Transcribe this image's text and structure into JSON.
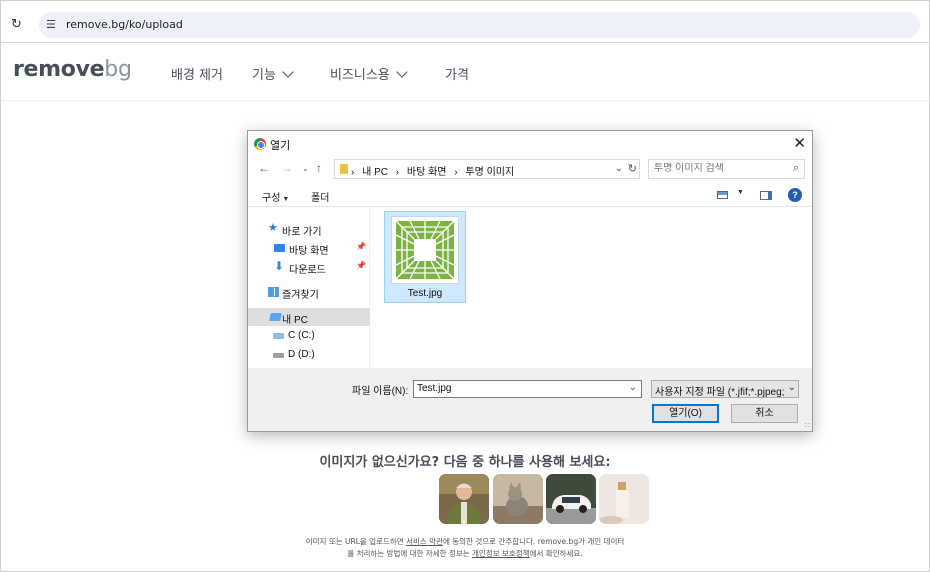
{
  "browser": {
    "url": "remove.bg/ko/upload"
  },
  "site": {
    "logo_main": "remove",
    "logo_accent": "bg",
    "nav": [
      {
        "label": "배경 제거",
        "dropdown": false
      },
      {
        "label": "기능",
        "dropdown": true
      },
      {
        "label": "비즈니스용",
        "dropdown": true
      },
      {
        "label": "가격",
        "dropdown": false
      }
    ]
  },
  "dialog": {
    "title": "열기",
    "path": [
      "내 PC",
      "바탕 화면",
      "투명 이미지"
    ],
    "search_placeholder": "투명 이미지 검색",
    "toolbar": {
      "organize": "구성",
      "new_folder": "폴더"
    },
    "sidebar": [
      {
        "label": "바로 가기",
        "icon": "star-icon"
      },
      {
        "label": "바탕 화면",
        "icon": "desktop-icon",
        "pinned": true
      },
      {
        "label": "다운로드",
        "icon": "download-icon",
        "pinned": true
      },
      {
        "label": "즐겨찾기",
        "icon": "favorites-icon"
      },
      {
        "label": "내 PC",
        "icon": "pc-icon",
        "selected": true
      },
      {
        "label": "C (C:)",
        "icon": "drive-c-icon"
      },
      {
        "label": "D (D:)",
        "icon": "drive-d-icon"
      }
    ],
    "files": [
      {
        "name": "Test.jpg",
        "selected": true
      }
    ],
    "filename_label": "파일 이름(N):",
    "filename_value": "Test.jpg",
    "filetype_value": "사용자 지정 파일 (*.jfif;*.pjpeg;",
    "open_label": "열기(O)",
    "cancel_label": "취소"
  },
  "page": {
    "prompt": "이미지가 없으신가요? 다음 중 하나를 사용해 보세요:",
    "samples": [
      "person-sample",
      "cat-sample",
      "car-sample",
      "cosmetics-sample"
    ],
    "terms_1a": "이미지 또는 URL을 업로드하면 ",
    "terms_link1": "서비스 약관",
    "terms_1b": "에 동의한 것으로 간주합니다. remove.bg가 개인 데이터",
    "terms_2a": "를 처리하는 방법에 대한 자세한 정보는 ",
    "terms_link2": "개인정보 보호정책",
    "terms_2b": "에서 확인하세요."
  }
}
